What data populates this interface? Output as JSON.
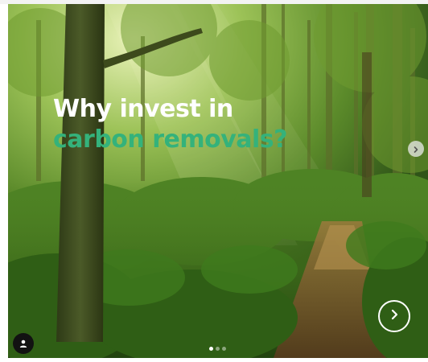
{
  "post": {
    "headline_line1": "Why invest in",
    "headline_line2": "carbon removals?",
    "colors": {
      "headline_primary": "#ffffff",
      "headline_accent": "#34b27b"
    },
    "carousel": {
      "slide_count": 3,
      "active_index": 0
    }
  },
  "icons": {
    "side_next": "chevron-right-icon",
    "overlay_next": "chevron-right-circle-icon",
    "user_tag": "person-icon"
  }
}
